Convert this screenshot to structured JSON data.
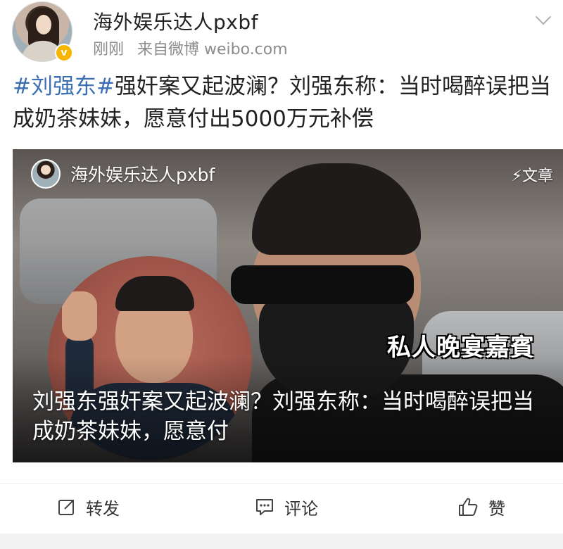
{
  "header": {
    "username": "海外娱乐达人pxbf",
    "time": "刚刚",
    "source": "来自微博 weibo.com",
    "verified_badge_icon": "v-badge-icon"
  },
  "post": {
    "hashtag": "#刘强东#",
    "text": "强奸案又起波澜？刘强东称：当时喝醉误把当成奶茶妹妹，愿意付出5000万元补偿"
  },
  "card": {
    "author": "海外娱乐达人pxbf",
    "type_label": "⚡文章",
    "image_overlay_text": "私人晚宴嘉賓",
    "title": "刘强东强奸案又起波澜？刘强东称：当时喝醉误把当成奶茶妹妹，愿意付"
  },
  "actions": {
    "repost": "转发",
    "comment": "评论",
    "like": "赞"
  },
  "colors": {
    "hashtag": "#3b6fb5",
    "verified": "#f7b500"
  }
}
